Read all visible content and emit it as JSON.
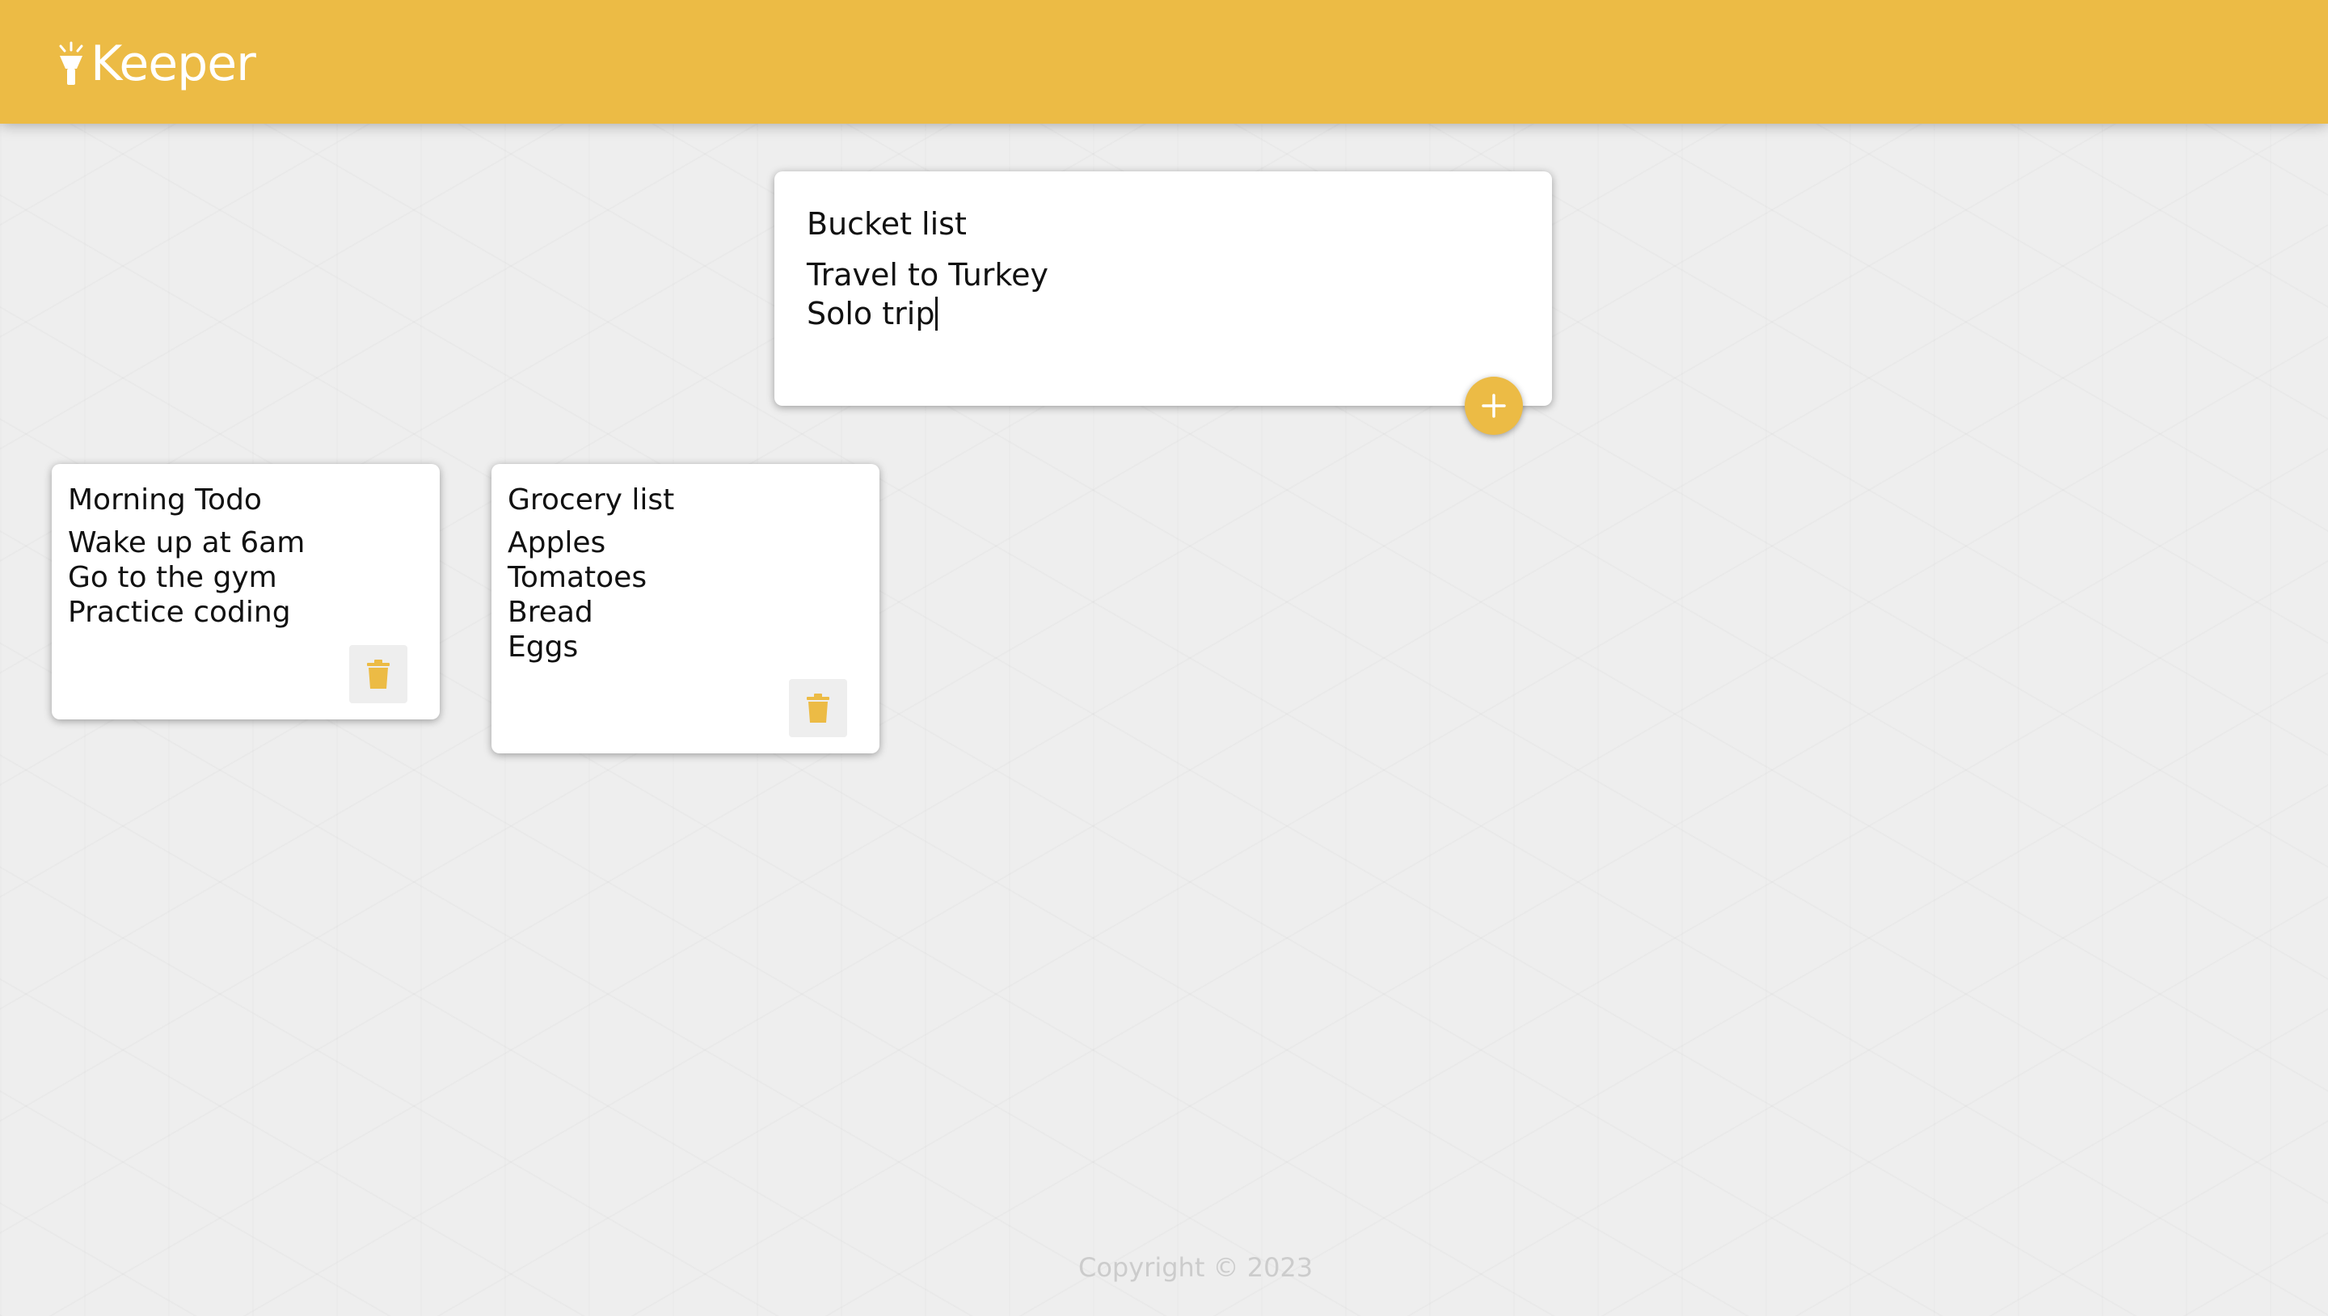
{
  "header": {
    "app_name": "Keeper",
    "logo_icon": "lamp-icon",
    "background_color": "#ecbb45"
  },
  "composer": {
    "title_value": "Bucket list",
    "content_lines": [
      "Travel to Turkey",
      "Solo trip"
    ],
    "add_button_icon": "plus-icon"
  },
  "notes": [
    {
      "title": "Morning Todo",
      "lines": [
        "Wake up at 6am",
        "Go to the gym",
        "Practice coding"
      ],
      "delete_icon": "trash-icon"
    },
    {
      "title": "Grocery list",
      "lines": [
        "Apples",
        "Tomatoes",
        "Bread",
        "Eggs"
      ],
      "delete_icon": "trash-icon"
    }
  ],
  "footer": {
    "copyright": "Copyright © 2023"
  },
  "colors": {
    "accent": "#ecbb45",
    "page_background": "#eeeeee",
    "card_background": "#ffffff",
    "footer_text": "#cccccc"
  }
}
